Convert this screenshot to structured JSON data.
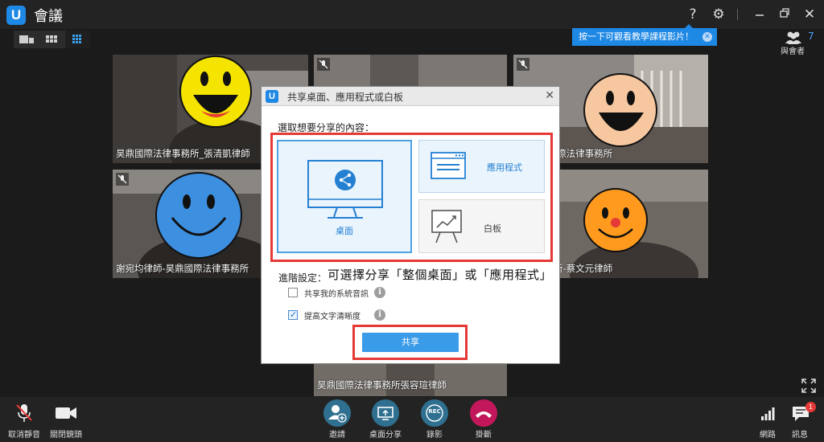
{
  "titlebar": {
    "app_logo": "U",
    "title": "會議",
    "icons": [
      "help-icon",
      "gear-icon",
      "minimize-icon",
      "restore-icon",
      "close-icon"
    ],
    "help_glyph": "?",
    "gear_glyph": "⚙",
    "close_glyph": "✕"
  },
  "tooltip": {
    "text": "按一下可觀看教學課程影片！",
    "close_glyph": "✕"
  },
  "participants": {
    "count": "7",
    "label": "與會者"
  },
  "tiles": [
    {
      "name": "昊鼎國際法律事務所_張清凱律師",
      "emoji_color": "#f5e400"
    },
    {
      "name": "",
      "emoji_color": ""
    },
    {
      "name": "師-昊鼎國際法律事務所",
      "emoji_color": "#f7c8a0"
    },
    {
      "name": "謝宛均律師-昊鼎國際法律事務所",
      "emoji_color": "#3d8fe0"
    },
    {
      "name": "法律事務所-蔡文元律師",
      "emoji_color": "#ff9a1f"
    },
    {
      "name": "昊鼎國際法律事務所張容瑄律師",
      "emoji_color": ""
    }
  ],
  "dialog": {
    "logo": "U",
    "title": "共享桌面、應用程式或白板",
    "close_glyph": "✕",
    "prompt": "選取想要分享的內容：",
    "options": {
      "desktop": "桌面",
      "application": "應用程式",
      "whiteboard": "白板"
    },
    "advanced_label": "進階設定：",
    "annotation": "可選擇分享「整個桌面」或「應用程式」",
    "checkboxes": [
      {
        "label": "共享我的系統音訊",
        "checked": false
      },
      {
        "label": "提高文字清晰度",
        "checked": true
      }
    ],
    "info_glyph": "i",
    "check_glyph": "✓",
    "share_button": "共享"
  },
  "bottombar": {
    "unmute": "取消靜音",
    "stop_video": "關閉鏡頭",
    "invite": "邀請",
    "share_desktop": "桌面分享",
    "record": "錄影",
    "record_glyph": "REC",
    "hangup": "掛斷",
    "network": "網路",
    "messages": "訊息",
    "messages_badge": "1"
  },
  "colors": {
    "accent": "#1e88e5",
    "highlight_red": "#e53935",
    "share_button": "#3a9be8",
    "hangup": "#c2185b",
    "action_circle": "#2f6f8f"
  }
}
